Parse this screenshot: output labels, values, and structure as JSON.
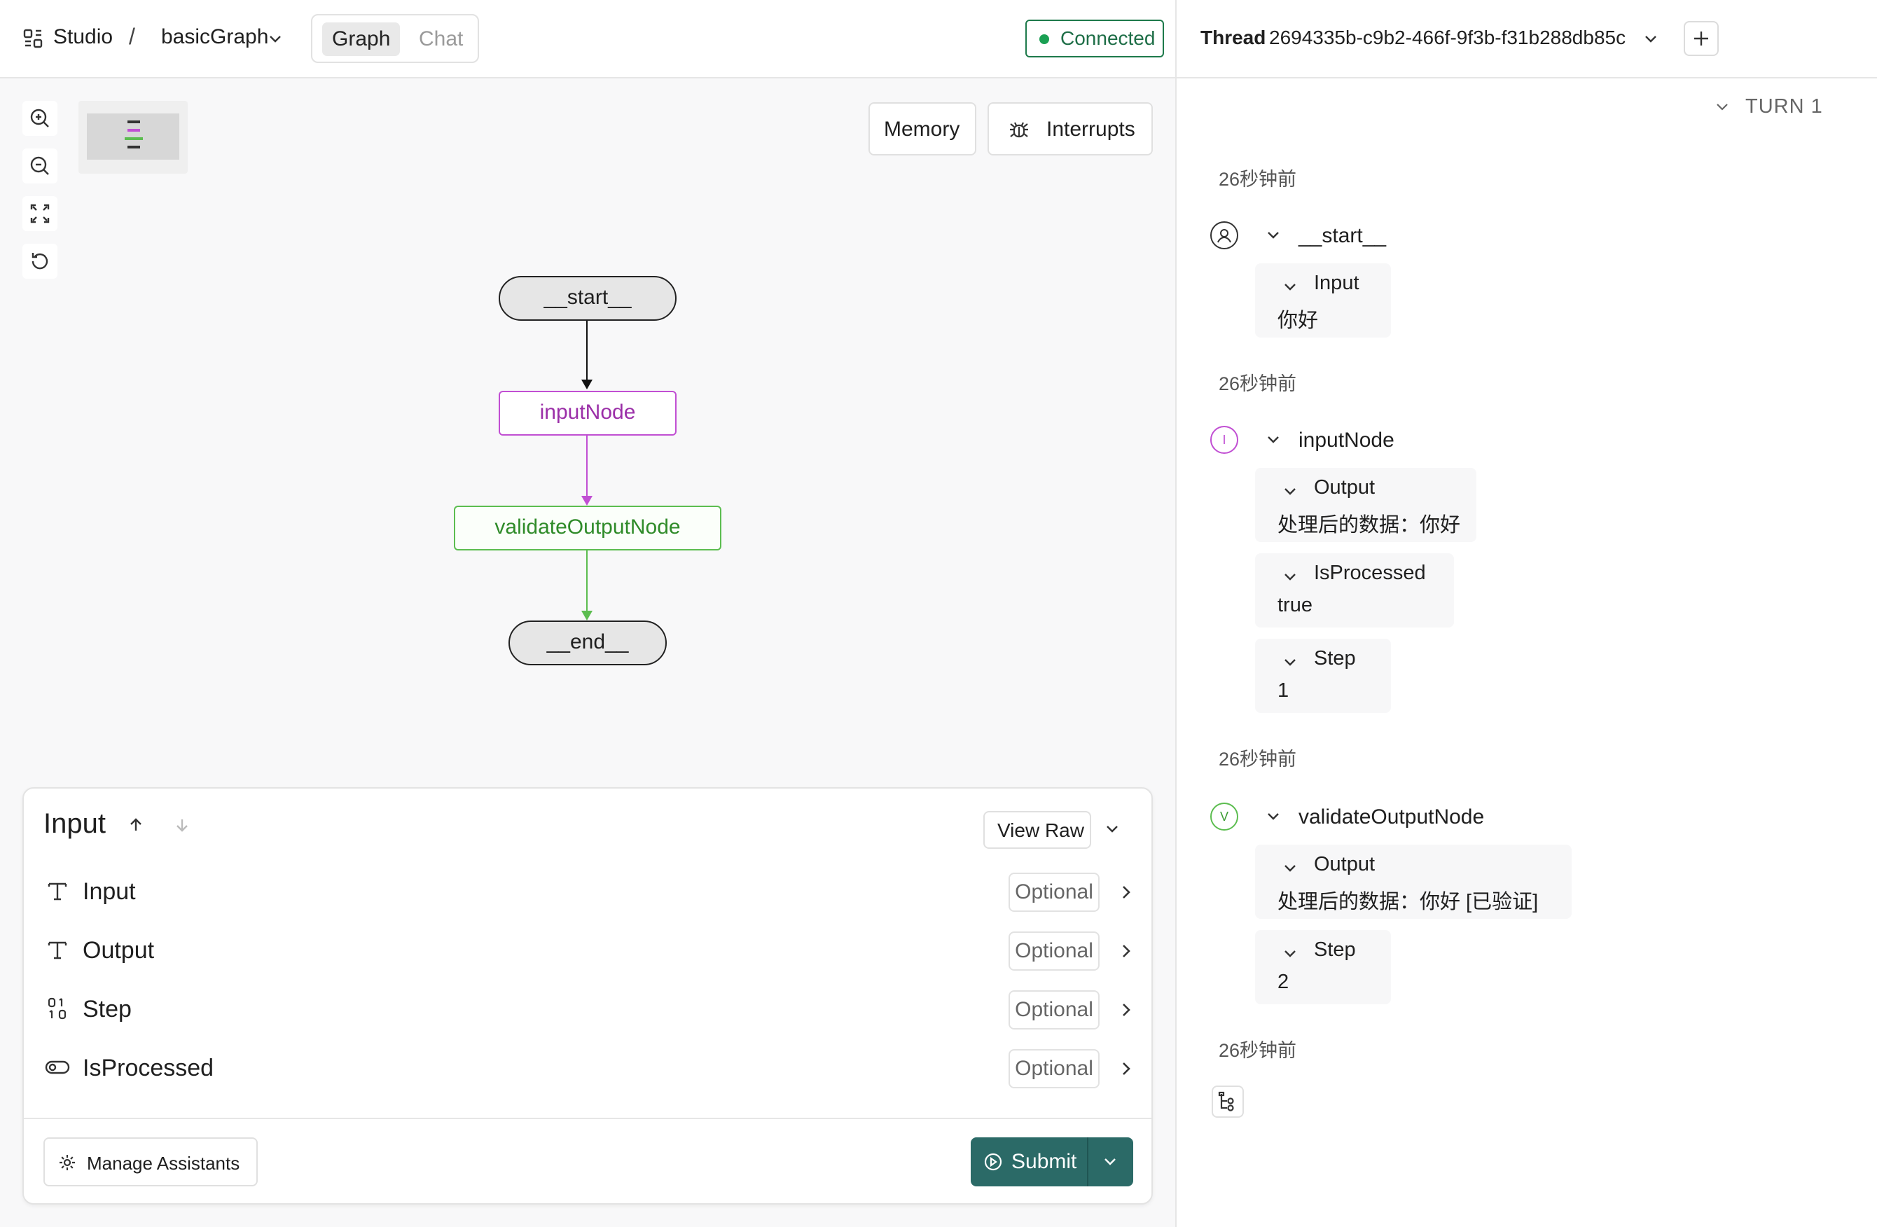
{
  "header": {
    "app_name": "Studio",
    "separator": "/",
    "graph_name": "basicGraph",
    "tabs": [
      {
        "label": "Graph",
        "active": true
      },
      {
        "label": "Chat",
        "active": false
      }
    ],
    "status": "Connected",
    "status_color": "#1aa053"
  },
  "thread": {
    "label": "Thread",
    "id": "2694335b-c9b2-466f-9f3b-f31b288db85c"
  },
  "canvas": {
    "memory_label": "Memory",
    "interrupts_label": "Interrupts",
    "nodes": {
      "start": "__start__",
      "input": "inputNode",
      "validate": "validateOutputNode",
      "end": "__end__"
    },
    "colors": {
      "input": "#c14fd3",
      "validate": "#5cbd50"
    }
  },
  "input_panel": {
    "title": "Input",
    "view_raw_label": "View Raw",
    "fields": [
      {
        "label": "Input",
        "badge": "Optional",
        "icon": "text-type-icon"
      },
      {
        "label": "Output",
        "badge": "Optional",
        "icon": "text-type-icon"
      },
      {
        "label": "Step",
        "badge": "Optional",
        "icon": "number-type-icon"
      },
      {
        "label": "IsProcessed",
        "badge": "Optional",
        "icon": "toggle-type-icon"
      }
    ],
    "manage_assistants_label": "Manage Assistants",
    "submit_label": "Submit"
  },
  "run": {
    "turn_label": "TURN 1",
    "steps": [
      {
        "time": "26秒钟前",
        "node": "__start__",
        "badge": "",
        "entries": [
          {
            "key": "Input",
            "value": "你好"
          }
        ]
      },
      {
        "time": "26秒钟前",
        "node": "inputNode",
        "badge": "I",
        "entries": [
          {
            "key": "Output",
            "value": "处理后的数据：你好"
          },
          {
            "key": "IsProcessed",
            "value": "true"
          },
          {
            "key": "Step",
            "value": "1"
          }
        ]
      },
      {
        "time": "26秒钟前",
        "node": "validateOutputNode",
        "badge": "V",
        "entries": [
          {
            "key": "Output",
            "value": "处理后的数据：你好 [已验证]"
          },
          {
            "key": "Step",
            "value": "2"
          }
        ]
      },
      {
        "time": "26秒钟前",
        "node": "",
        "badge": "",
        "entries": []
      }
    ]
  }
}
